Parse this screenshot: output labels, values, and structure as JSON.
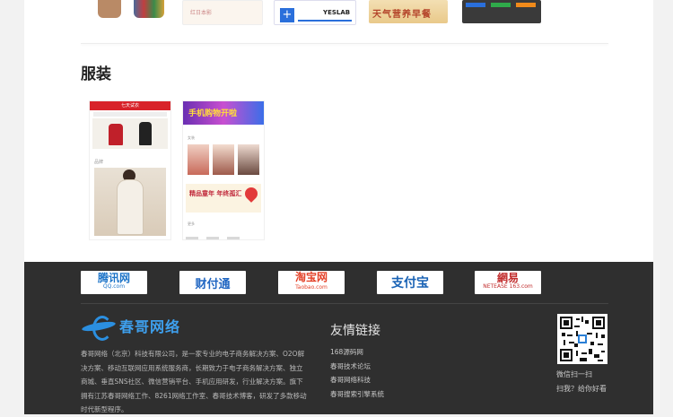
{
  "top_strip": {
    "card1_text": "红日本影",
    "yeslab_label": "YESLAB",
    "tian_text": "天气营养早餐"
  },
  "section": {
    "title": "服装"
  },
  "previews": [
    {
      "header": "七天试衣",
      "label": "品牌"
    },
    {
      "header": "手机购物开啦",
      "label": "女装",
      "promo": "精品童年 年终孤汇",
      "footer": "更多"
    }
  ],
  "footer": {
    "partners": [
      {
        "name": "腾讯网",
        "sub": "QQ.com"
      },
      {
        "name": "财付通",
        "sub": ""
      },
      {
        "name": "淘宝网",
        "sub": "Taobao.com"
      },
      {
        "name": "支付宝",
        "sub": ""
      },
      {
        "name": "網易",
        "sub": "NETEASE 163.com"
      }
    ],
    "brand_name": "春哥网络",
    "about": "春哥网络（北京）科技有限公司，是一家专业的电子商务解决方案、O2O解决方案、移动互联网应用系统服务商，长期致力于电子商务解决方案、独立商城、垂直SNS社区、微信营销平台、手机应用研发，行业解决方案。旗下拥有江苏春哥网络工作、8261网络工作室、春哥技术博客，研发了多款移动时代新型程序。",
    "links_title": "友情链接",
    "links": [
      "168源码网",
      "春哥技术论坛",
      "春哥网络科技",
      "春哥搜索引擎系统"
    ],
    "qr_lines": [
      "微信扫一扫",
      "扫我？给你好看"
    ]
  },
  "colors": {
    "footer_bg": "#2f2f2f",
    "brand_blue": "#3ea0ee",
    "accent_red": "#d8232a"
  }
}
